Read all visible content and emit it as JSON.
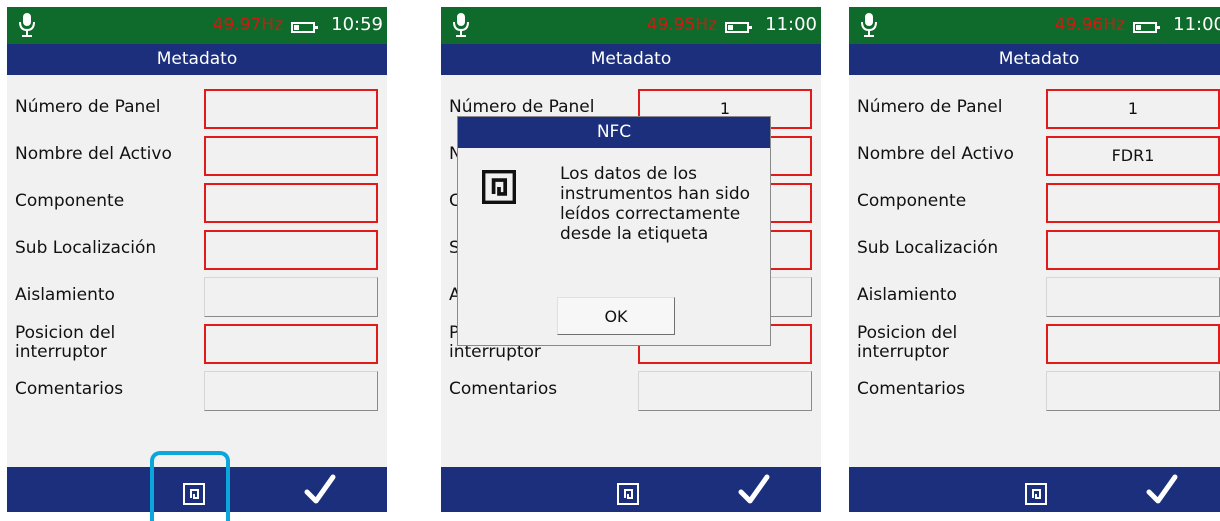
{
  "app": {
    "title": "Metadato"
  },
  "labels": {
    "panel": "Número de Panel",
    "asset": "Nombre del Activo",
    "component": "Componente",
    "sublocation": "Sub Localización",
    "insulation": "Aislamiento",
    "breaker_position": "Posicion del interruptor",
    "comments": "Comentarios"
  },
  "screens": [
    {
      "status": {
        "frequency": "49.97Hz",
        "time": "10:59"
      },
      "values": {
        "panel": "",
        "asset": "",
        "component": "",
        "sublocation": "",
        "insulation": "",
        "breaker_position": "",
        "comments": ""
      }
    },
    {
      "status": {
        "frequency": "49.95Hz",
        "time": "11:00"
      },
      "values": {
        "panel": "1",
        "asset": "",
        "component": "",
        "sublocation": "",
        "insulation": "",
        "breaker_position": "",
        "comments": ""
      },
      "dialog": {
        "title": "NFC",
        "message": "Los datos de los instrumentos han sido leídos correctamente desde la etiqueta",
        "ok_label": "OK"
      }
    },
    {
      "status": {
        "frequency": "49.96Hz",
        "time": "11:00"
      },
      "values": {
        "panel": "1",
        "asset": "FDR1",
        "component": "",
        "sublocation": "",
        "insulation": "",
        "breaker_position": "",
        "comments": ""
      }
    }
  ],
  "battery_level": 0.25,
  "icons": {
    "status": "microphone-icon",
    "nfc": "nfc-icon",
    "confirm": "checkmark-icon"
  },
  "colors": {
    "status_bar": "#0f6b2c",
    "title_bar": "#1c2f7c",
    "frequency_text": "#cc1b10",
    "required_border": "#e11a1a",
    "highlight": "#0aa6dc"
  }
}
